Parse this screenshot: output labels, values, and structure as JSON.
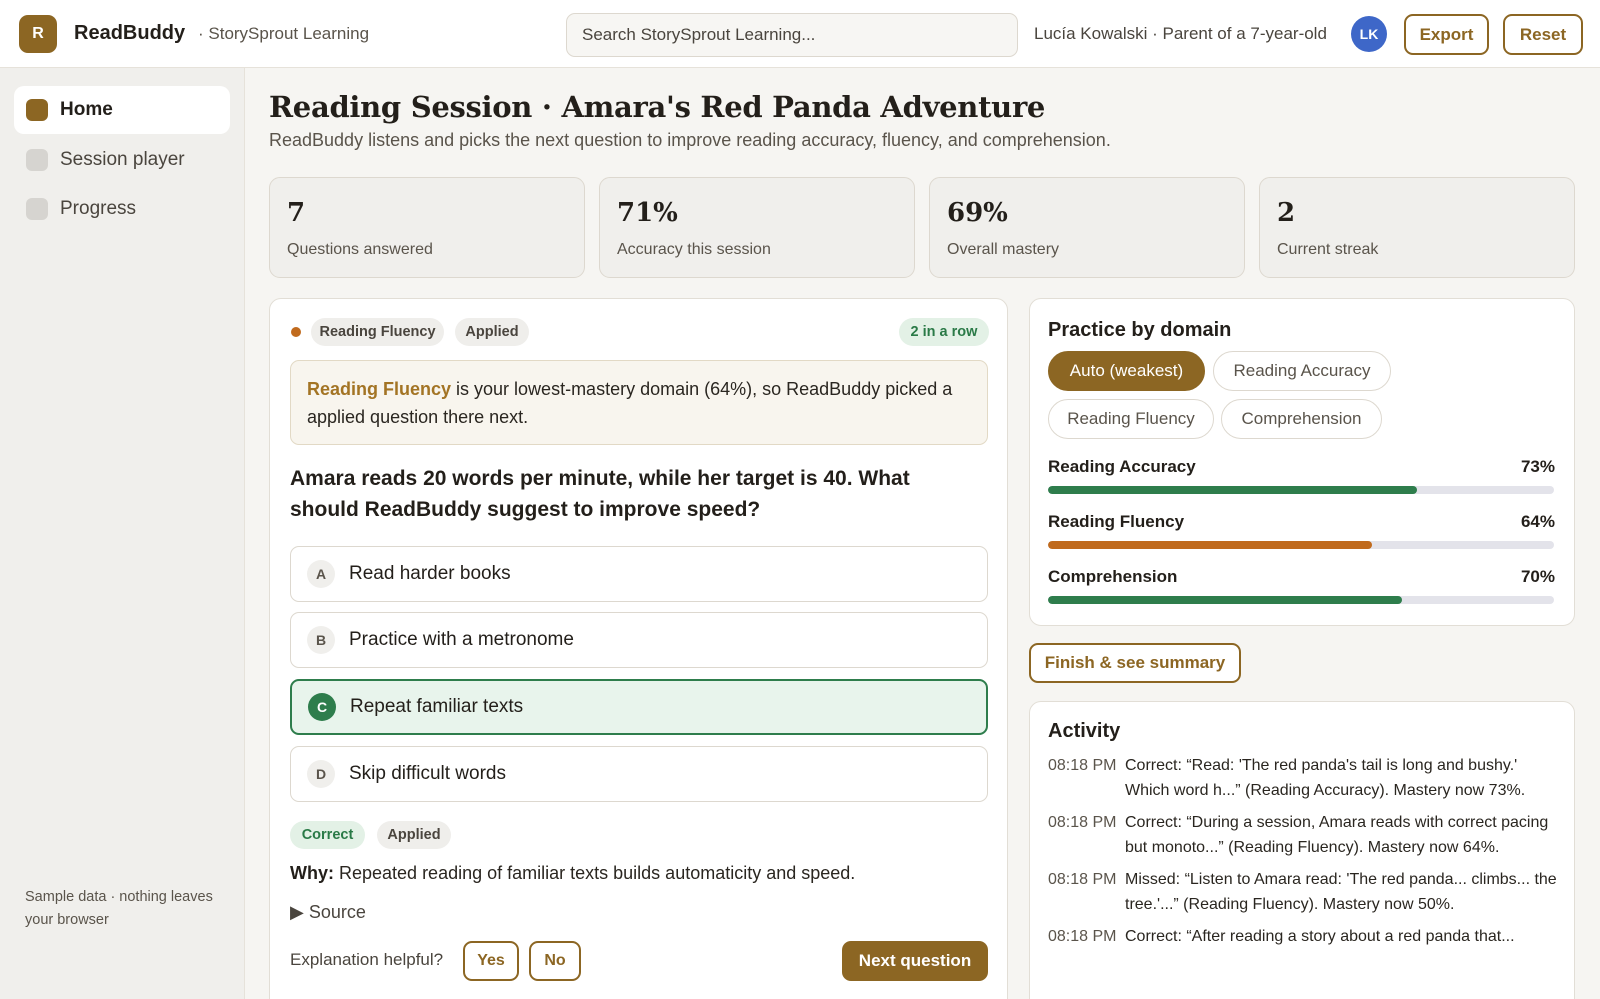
{
  "header": {
    "logo_letter": "R",
    "app_name": "ReadBuddy",
    "org": "· StorySprout Learning",
    "search_placeholder": "Search StorySprout Learning...",
    "user": "Lucía Kowalski · Parent of a 7-year-old",
    "avatar_initials": "LK",
    "export_label": "Export",
    "reset_label": "Reset"
  },
  "sidebar": {
    "items": [
      {
        "label": "Home",
        "active": true
      },
      {
        "label": "Session player",
        "active": false
      },
      {
        "label": "Progress",
        "active": false
      }
    ],
    "footer": "Sample data · nothing leaves your browser"
  },
  "page": {
    "title": "Reading Session · Amara's Red Panda Adventure",
    "subtitle": "ReadBuddy listens and picks the next question to improve reading accuracy, fluency, and comprehension."
  },
  "stats": [
    {
      "value": "7",
      "label": "Questions answered"
    },
    {
      "value": "71%",
      "label": "Accuracy this session"
    },
    {
      "value": "69%",
      "label": "Overall mastery"
    },
    {
      "value": "2",
      "label": "Current streak"
    }
  ],
  "question": {
    "domain_chip": "Reading Fluency",
    "type_chip": "Applied",
    "streak_chip": "2 in a row",
    "note_highlight": "Reading Fluency",
    "note_text": " is your lowest-mastery domain (64%), so ReadBuddy picked a applied question there next.",
    "text": "Amara reads 20 words per minute, while her target is 40. What should ReadBuddy suggest to improve speed?",
    "options": [
      {
        "letter": "A",
        "text": "Read harder books",
        "selected": false
      },
      {
        "letter": "B",
        "text": "Practice with a metronome",
        "selected": false
      },
      {
        "letter": "C",
        "text": "Repeat familiar texts",
        "selected": true
      },
      {
        "letter": "D",
        "text": "Skip difficult words",
        "selected": false
      }
    ],
    "result_chip": "Correct",
    "result_type_chip": "Applied",
    "why_label": "Why:",
    "why_text": " Repeated reading of familiar texts builds automaticity and speed.",
    "source_label": "▶ Source",
    "feedback_prompt": "Explanation helpful?",
    "yes_label": "Yes",
    "no_label": "No",
    "next_label": "Next question"
  },
  "practice": {
    "title": "Practice by domain",
    "pills": [
      {
        "label": "Auto (weakest)",
        "active": true
      },
      {
        "label": "Reading Accuracy",
        "active": false
      },
      {
        "label": "Reading Fluency",
        "active": false
      },
      {
        "label": "Comprehension",
        "active": false
      }
    ],
    "domains": [
      {
        "name": "Reading Accuracy",
        "pct_label": "73%",
        "pct": 73,
        "color": "#2e7d4c"
      },
      {
        "name": "Reading Fluency",
        "pct_label": "64%",
        "pct": 64,
        "color": "#c06a1d"
      },
      {
        "name": "Comprehension",
        "pct_label": "70%",
        "pct": 70,
        "color": "#2e7d4c"
      }
    ]
  },
  "finish_label": "Finish & see summary",
  "activity": {
    "title": "Activity",
    "items": [
      {
        "time": "08:18 PM",
        "text": "Correct: “Read: 'The red panda's tail is long and bushy.' Which word h...” (Reading Accuracy). Mastery now 73%."
      },
      {
        "time": "08:18 PM",
        "text": "Correct: “During a session, Amara reads with correct pacing but monoto...” (Reading Fluency). Mastery now 64%."
      },
      {
        "time": "08:18 PM",
        "text": "Missed: “Listen to Amara read: 'The red panda... climbs... the tree.'...” (Reading Fluency). Mastery now 50%."
      },
      {
        "time": "08:18 PM",
        "text": "Correct: “After reading a story about a red panda that..."
      }
    ]
  }
}
